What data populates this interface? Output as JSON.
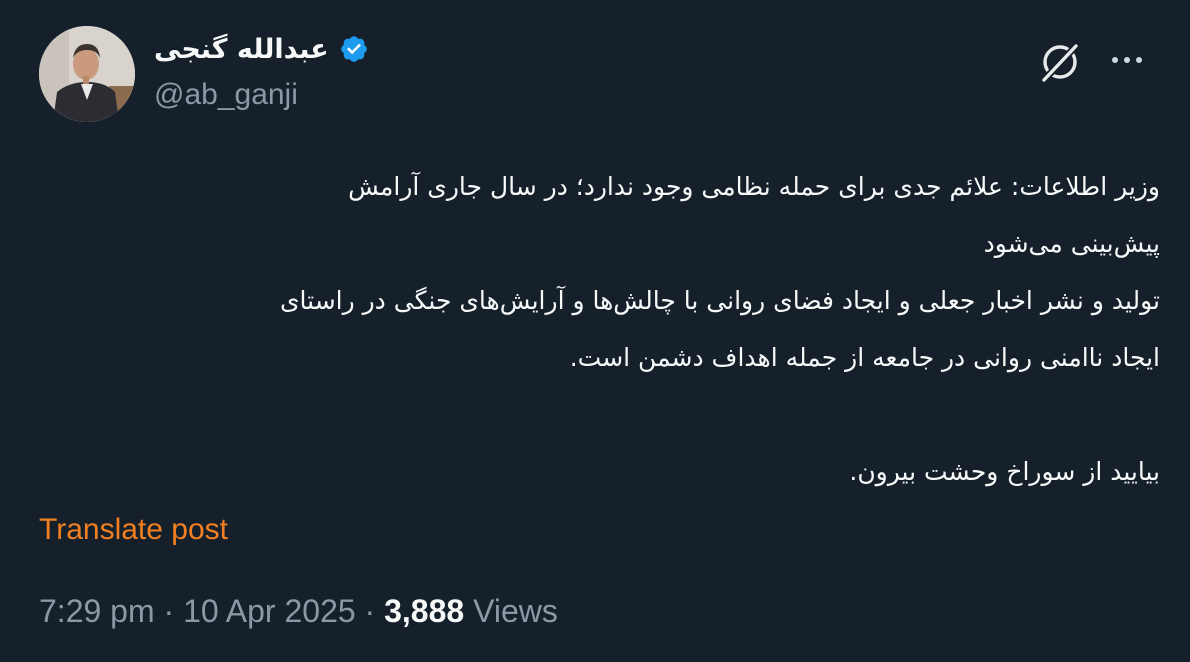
{
  "author": {
    "display_name": "عبدالله گنجی",
    "handle": "@ab_ganji",
    "verified": true
  },
  "actions": {
    "grok_icon": "grok-icon",
    "more_icon": "more-dots-icon"
  },
  "post": {
    "lines": [
      "وزیر اطلاعات: علائم جدی برای حمله نظامی وجود ندارد؛ در سال جاری آرامش",
      "پیش‌بینی می‌شود",
      "تولید و نشر اخبار جعلی و ایجاد فضای روانی با چالش‌ها و آرایش‌های جنگی در راستای",
      "ایجاد ناامنی روانی در جامعه از جمله اهداف دشمن است.",
      "",
      "بیایید از سوراخ وحشت بیرون."
    ]
  },
  "translate_label": "Translate post",
  "meta": {
    "time": "7:29 pm",
    "separator": " · ",
    "date": "10 Apr 2025",
    "views_count": "3,888",
    "views_label": "Views"
  },
  "colors": {
    "background": "#15202b",
    "text": "#f7f9f9",
    "secondary": "#8b98a5",
    "accent": "#f27f22",
    "verified": "#1d9bf0"
  }
}
